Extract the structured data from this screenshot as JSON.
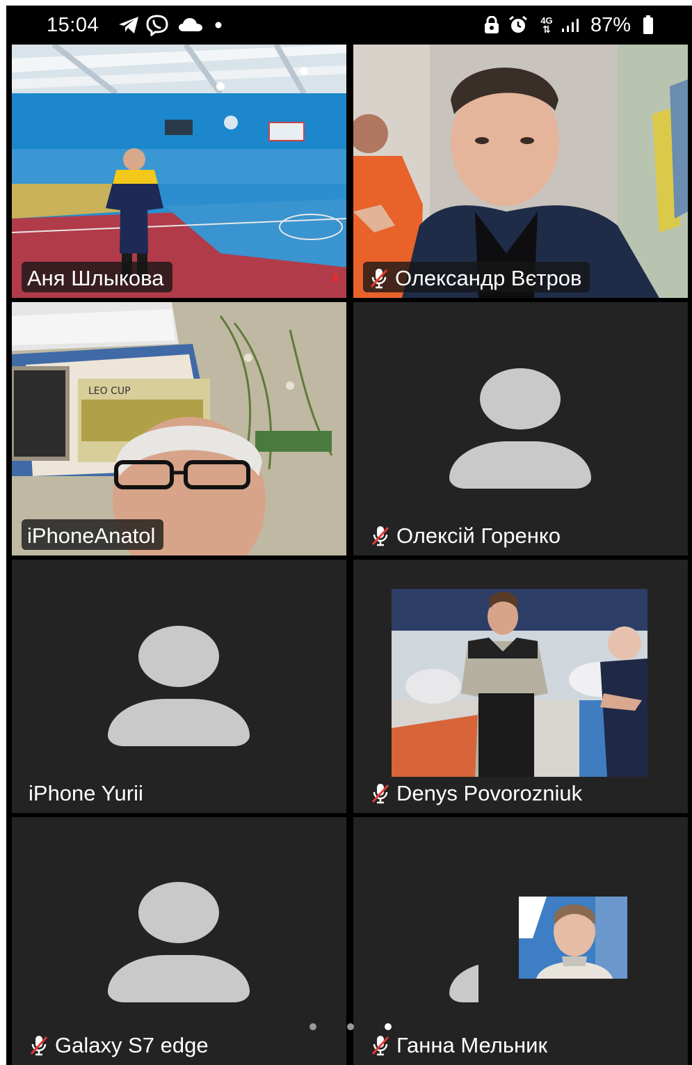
{
  "status_bar": {
    "time": "15:04",
    "network": "4G",
    "battery": "87%",
    "icons": [
      "telegram-icon",
      "viber-icon",
      "cloud-icon",
      "dot-icon",
      "vpn-icon",
      "alarm-icon",
      "network-4g-icon",
      "signal-icon",
      "battery-icon"
    ]
  },
  "participants": [
    {
      "name": "Аня Шлыкова",
      "muted": false,
      "video": true,
      "speaking": true
    },
    {
      "name": "Олександр Вєтров",
      "muted": true,
      "video": true
    },
    {
      "name": "iPhoneAnatol",
      "muted": false,
      "video": true
    },
    {
      "name": "Олексій Горенко",
      "muted": true,
      "video": false
    },
    {
      "name": "iPhone Yurii",
      "muted": false,
      "video": false
    },
    {
      "name": "Denys Povorozniuk",
      "muted": true,
      "video": false,
      "profile_photo": true
    },
    {
      "name": "Galaxy S7 edge",
      "muted": true,
      "video": false
    },
    {
      "name": "Ганна Мельник",
      "muted": true,
      "video": false,
      "profile_photo": true
    }
  ],
  "pagination": {
    "pages": 3,
    "active": 2
  },
  "colors": {
    "background": "#000000",
    "tile": "#232323",
    "speaking_border": "#3bd16f",
    "avatar": "#c9c9c9",
    "mute_slash": "#e53935"
  }
}
